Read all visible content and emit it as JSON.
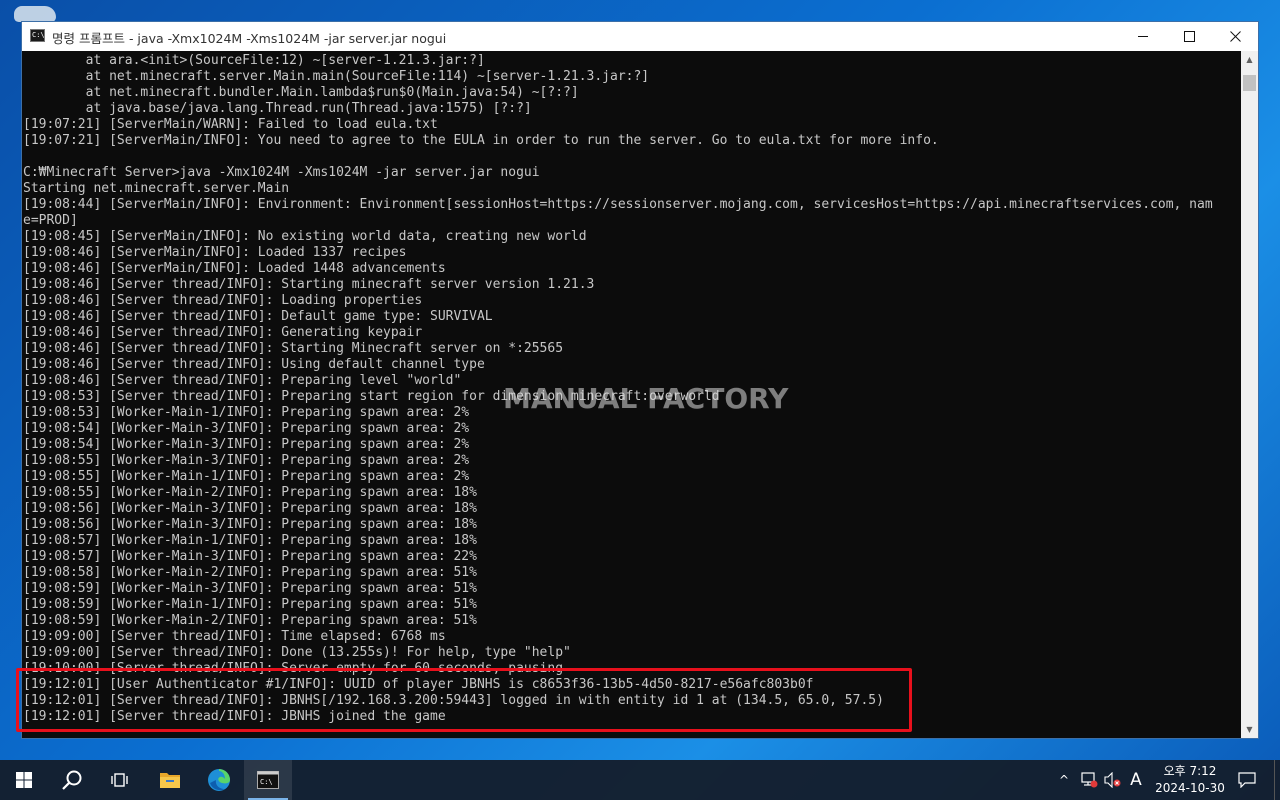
{
  "window": {
    "title": "명령 프롬프트 - java  -Xmx1024M -Xms1024M -jar server.jar nogui",
    "icon": "cmd-icon"
  },
  "console_lines": [
    "        at ara.<init>(SourceFile:12) ~[server-1.21.3.jar:?]",
    "        at net.minecraft.server.Main.main(SourceFile:114) ~[server-1.21.3.jar:?]",
    "        at net.minecraft.bundler.Main.lambda$run$0(Main.java:54) ~[?:?]",
    "        at java.base/java.lang.Thread.run(Thread.java:1575) [?:?]",
    "[19:07:21] [ServerMain/WARN]: Failed to load eula.txt",
    "[19:07:21] [ServerMain/INFO]: You need to agree to the EULA in order to run the server. Go to eula.txt for more info.",
    "",
    "C:₩Minecraft Server>java -Xmx1024M -Xms1024M -jar server.jar nogui",
    "Starting net.minecraft.server.Main",
    "[19:08:44] [ServerMain/INFO]: Environment: Environment[sessionHost=https://sessionserver.mojang.com, servicesHost=https://api.minecraftservices.com, nam",
    "e=PROD]",
    "[19:08:45] [ServerMain/INFO]: No existing world data, creating new world",
    "[19:08:46] [ServerMain/INFO]: Loaded 1337 recipes",
    "[19:08:46] [ServerMain/INFO]: Loaded 1448 advancements",
    "[19:08:46] [Server thread/INFO]: Starting minecraft server version 1.21.3",
    "[19:08:46] [Server thread/INFO]: Loading properties",
    "[19:08:46] [Server thread/INFO]: Default game type: SURVIVAL",
    "[19:08:46] [Server thread/INFO]: Generating keypair",
    "[19:08:46] [Server thread/INFO]: Starting Minecraft server on *:25565",
    "[19:08:46] [Server thread/INFO]: Using default channel type",
    "[19:08:46] [Server thread/INFO]: Preparing level \"world\"",
    "[19:08:53] [Server thread/INFO]: Preparing start region for dimension minecraft:overworld",
    "[19:08:53] [Worker-Main-1/INFO]: Preparing spawn area: 2%",
    "[19:08:54] [Worker-Main-3/INFO]: Preparing spawn area: 2%",
    "[19:08:54] [Worker-Main-3/INFO]: Preparing spawn area: 2%",
    "[19:08:55] [Worker-Main-3/INFO]: Preparing spawn area: 2%",
    "[19:08:55] [Worker-Main-1/INFO]: Preparing spawn area: 2%",
    "[19:08:55] [Worker-Main-2/INFO]: Preparing spawn area: 18%",
    "[19:08:56] [Worker-Main-3/INFO]: Preparing spawn area: 18%",
    "[19:08:56] [Worker-Main-3/INFO]: Preparing spawn area: 18%",
    "[19:08:57] [Worker-Main-1/INFO]: Preparing spawn area: 18%",
    "[19:08:57] [Worker-Main-3/INFO]: Preparing spawn area: 22%",
    "[19:08:58] [Worker-Main-2/INFO]: Preparing spawn area: 51%",
    "[19:08:59] [Worker-Main-3/INFO]: Preparing spawn area: 51%",
    "[19:08:59] [Worker-Main-1/INFO]: Preparing spawn area: 51%",
    "[19:08:59] [Worker-Main-2/INFO]: Preparing spawn area: 51%",
    "[19:09:00] [Server thread/INFO]: Time elapsed: 6768 ms",
    "[19:09:00] [Server thread/INFO]: Done (13.255s)! For help, type \"help\"",
    "[19:10:00] [Server thread/INFO]: Server empty for 60 seconds, pausing",
    "[19:12:01] [User Authenticator #1/INFO]: UUID of player JBNHS is c8653f36-13b5-4d50-8217-e56afc803b0f",
    "[19:12:01] [Server thread/INFO]: JBNHS[/192.168.3.200:59443] logged in with entity id 1 at (134.5, 65.0, 57.5)",
    "[19:12:01] [Server thread/INFO]: JBNHS joined the game"
  ],
  "watermark": "MANUAL FACTORY",
  "taskbar": {
    "apps": [
      "start-icon",
      "search-icon",
      "task-view-icon",
      "file-explorer-icon",
      "edge-icon",
      "cmd-icon"
    ],
    "tray_chevron": "^",
    "ime": "A",
    "clock_time": "오후 7:12",
    "clock_date": "2024-10-30"
  },
  "colors": {
    "console_bg": "#0c0c0c",
    "console_text": "#c7c7c7",
    "highlight": "#e8101c"
  }
}
